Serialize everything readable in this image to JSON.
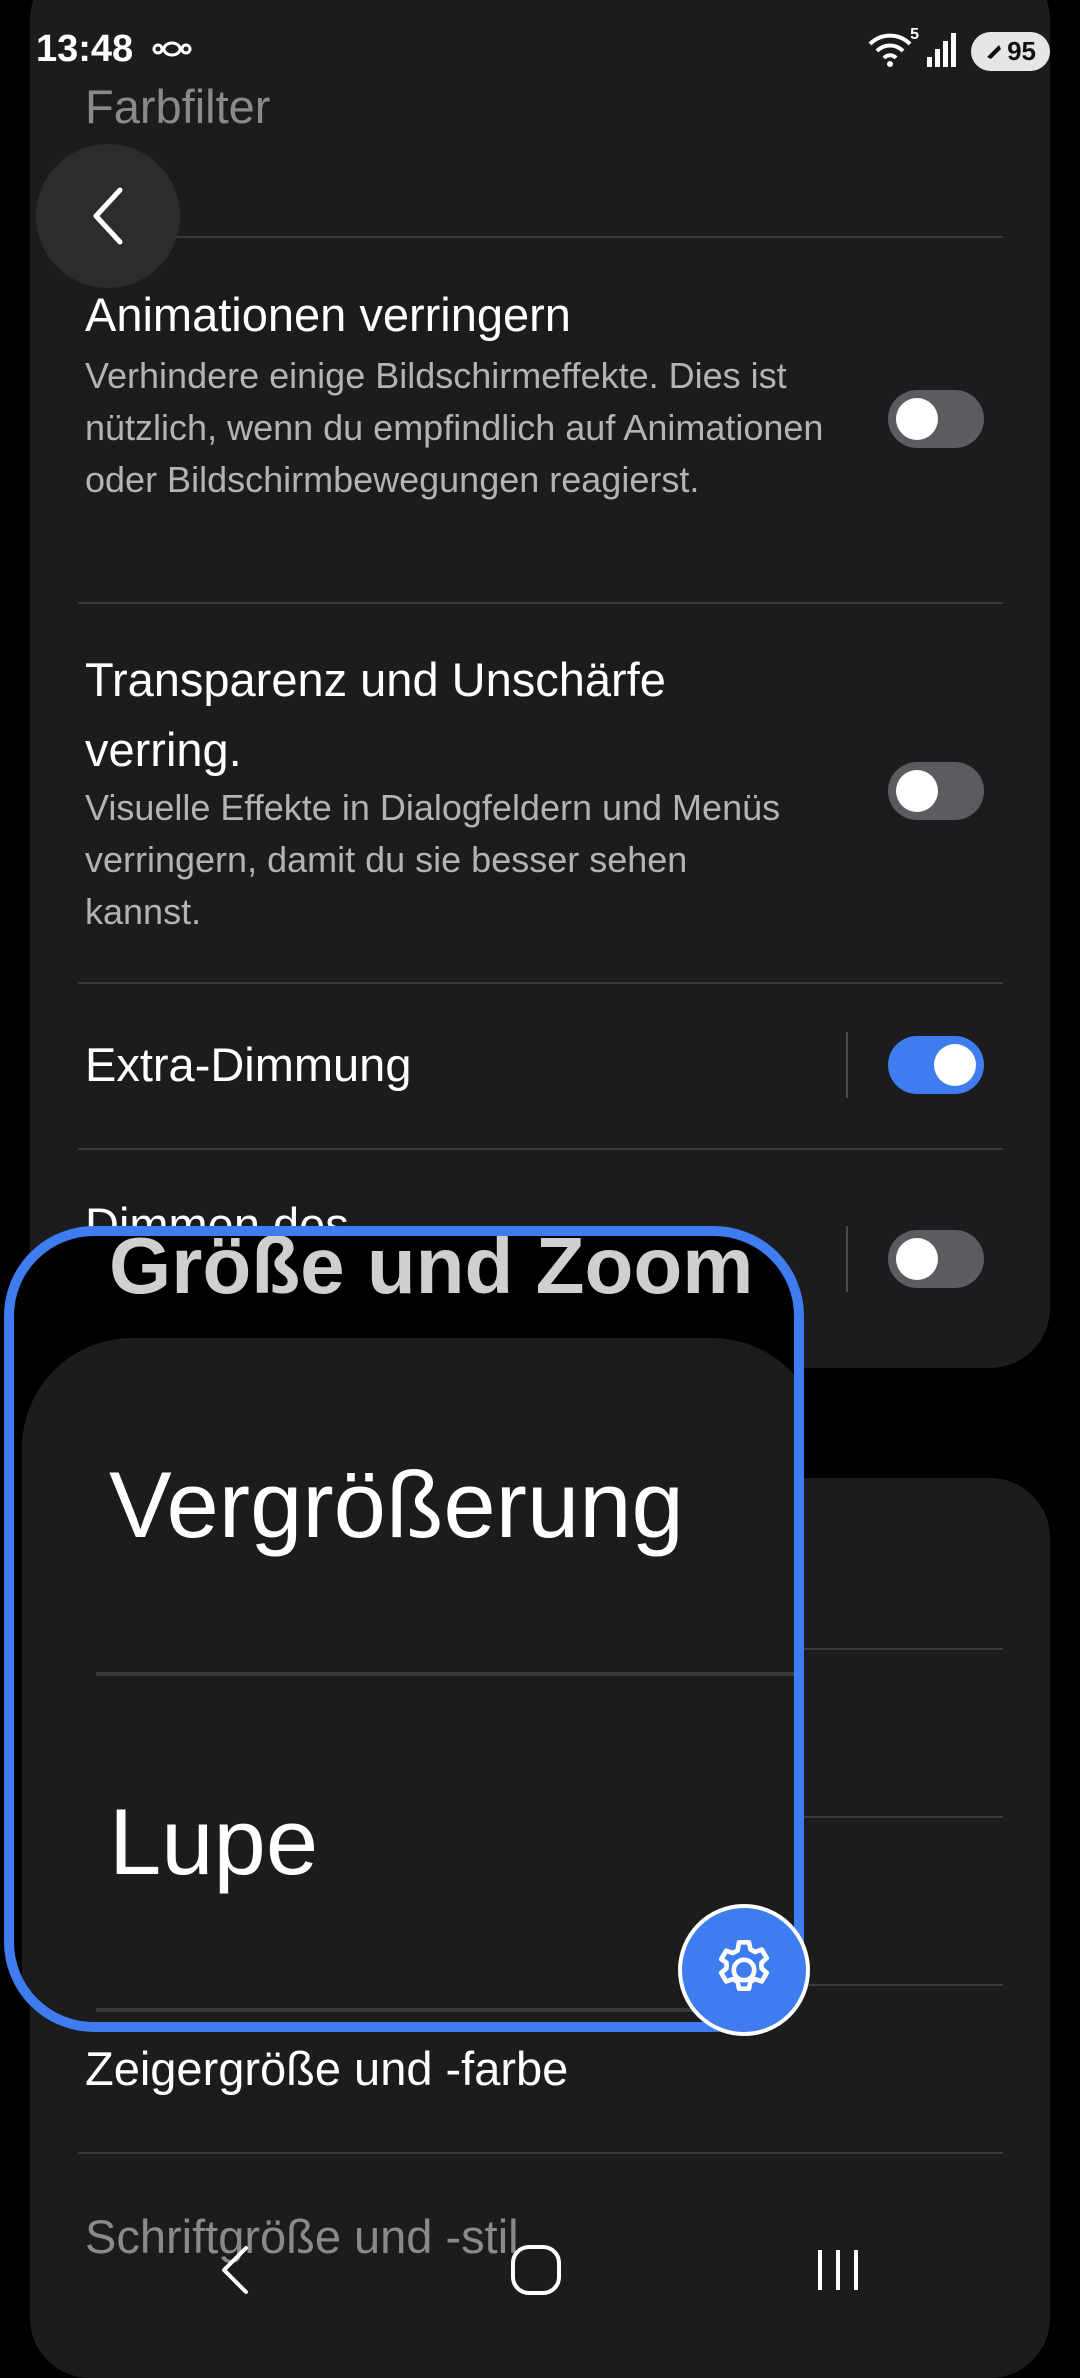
{
  "status": {
    "time": "13:48",
    "battery": "95",
    "wifi_badge": "5"
  },
  "settings": {
    "farbfilter": "Farbfilter",
    "animationen": {
      "title": "Animationen verringern",
      "desc": "Verhindere einige Bildschirmeffekte. Dies ist nützlich, wenn du empfindlich auf Animationen oder Bildschirmbewegungen reagierst.",
      "enabled": false
    },
    "transparenz": {
      "title": "Transparenz und Unschärfe verring.",
      "desc": "Visuelle Effekte in Dialogfeldern und Menüs verringern, damit du sie besser sehen kannst.",
      "enabled": false
    },
    "extra_dimmung": {
      "title": "Extra-Dimmung",
      "enabled": true
    },
    "dimmen": {
      "title": "Dimmen des",
      "enabled": false
    },
    "zeiger": "Zeigergröße und -farbe",
    "schrift": "Schriftgröße und -stil"
  },
  "magnifier": {
    "header": "Größe und Zoom",
    "item1": "Vergrößerung",
    "item2": "Lupe"
  },
  "colors": {
    "accent": "#3e7cf0",
    "card": "#1c1c1e",
    "background": "#000000"
  },
  "icons": {
    "back": "chevron-left-icon",
    "gear": "gear-icon",
    "nav_back": "nav-back-icon",
    "nav_home": "nav-home-icon",
    "nav_recents": "nav-recents-icon"
  }
}
